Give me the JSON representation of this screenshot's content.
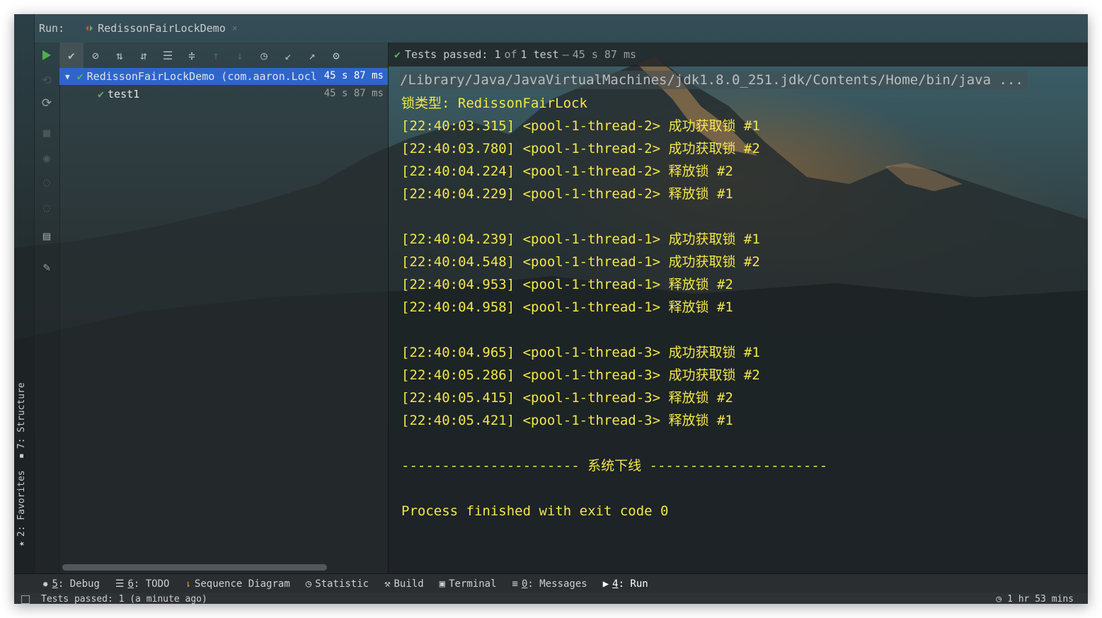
{
  "run_header": {
    "label": "Run:",
    "tab_title": "RedissonFairLockDemo",
    "close": "×"
  },
  "side_tabs": {
    "structure": "7: Structure",
    "favorites": "2: Favorites"
  },
  "tree": {
    "root": {
      "label": "RedissonFairLockDemo (com.aaron.Locl",
      "time": "45 s 87 ms"
    },
    "child": {
      "label": "test1",
      "time": "45 s 87 ms"
    }
  },
  "console": {
    "status": {
      "prefix": "Tests passed:",
      "count": "1",
      "of": "of",
      "total": "1 test",
      "sep": "–",
      "duration": "45 s 87 ms"
    },
    "command": "/Library/Java/JavaVirtualMachines/jdk1.8.0_251.jdk/Contents/Home/bin/java ...",
    "lines": [
      "锁类型: RedissonFairLock",
      "[22:40:03.315]  <pool-1-thread-2> 成功获取锁 #1",
      "[22:40:03.780]  <pool-1-thread-2> 成功获取锁 #2",
      "[22:40:04.224]  <pool-1-thread-2> 释放锁 #2",
      "[22:40:04.229]  <pool-1-thread-2> 释放锁 #1",
      "",
      "[22:40:04.239]  <pool-1-thread-1> 成功获取锁 #1",
      "[22:40:04.548]  <pool-1-thread-1> 成功获取锁 #2",
      "[22:40:04.953]  <pool-1-thread-1> 释放锁 #2",
      "[22:40:04.958]  <pool-1-thread-1> 释放锁 #1",
      "",
      "[22:40:04.965]  <pool-1-thread-3> 成功获取锁 #1",
      "[22:40:05.286]  <pool-1-thread-3> 成功获取锁 #2",
      "[22:40:05.415]  <pool-1-thread-3> 释放锁 #2",
      "[22:40:05.421]  <pool-1-thread-3> 释放锁 #1",
      "",
      "---------------------- 系统下线 ----------------------",
      "",
      "Process finished with exit code 0"
    ]
  },
  "bottom_tabs": [
    {
      "num": "5",
      "label": ": Debug",
      "icon": "bug-icon"
    },
    {
      "num": "6",
      "label": ": TODO",
      "icon": "list-icon"
    },
    {
      "num": "",
      "label": "Sequence Diagram",
      "icon": "sequence-icon"
    },
    {
      "num": "",
      "label": "Statistic",
      "icon": "statistic-icon"
    },
    {
      "num": "",
      "label": "Build",
      "icon": "hammer-icon"
    },
    {
      "num": "",
      "label": "Terminal",
      "icon": "terminal-icon"
    },
    {
      "num": "0",
      "label": ": Messages",
      "icon": "messages-icon"
    },
    {
      "num": "4",
      "label": ": Run",
      "icon": "run-icon"
    }
  ],
  "status_bar": {
    "text": "Tests passed: 1 (a minute ago)",
    "right": "1 hr 53 mins"
  },
  "colors": {
    "console_text": "#f3e64b",
    "selection": "#2f65ca",
    "pass_green": "#5fb05a"
  }
}
